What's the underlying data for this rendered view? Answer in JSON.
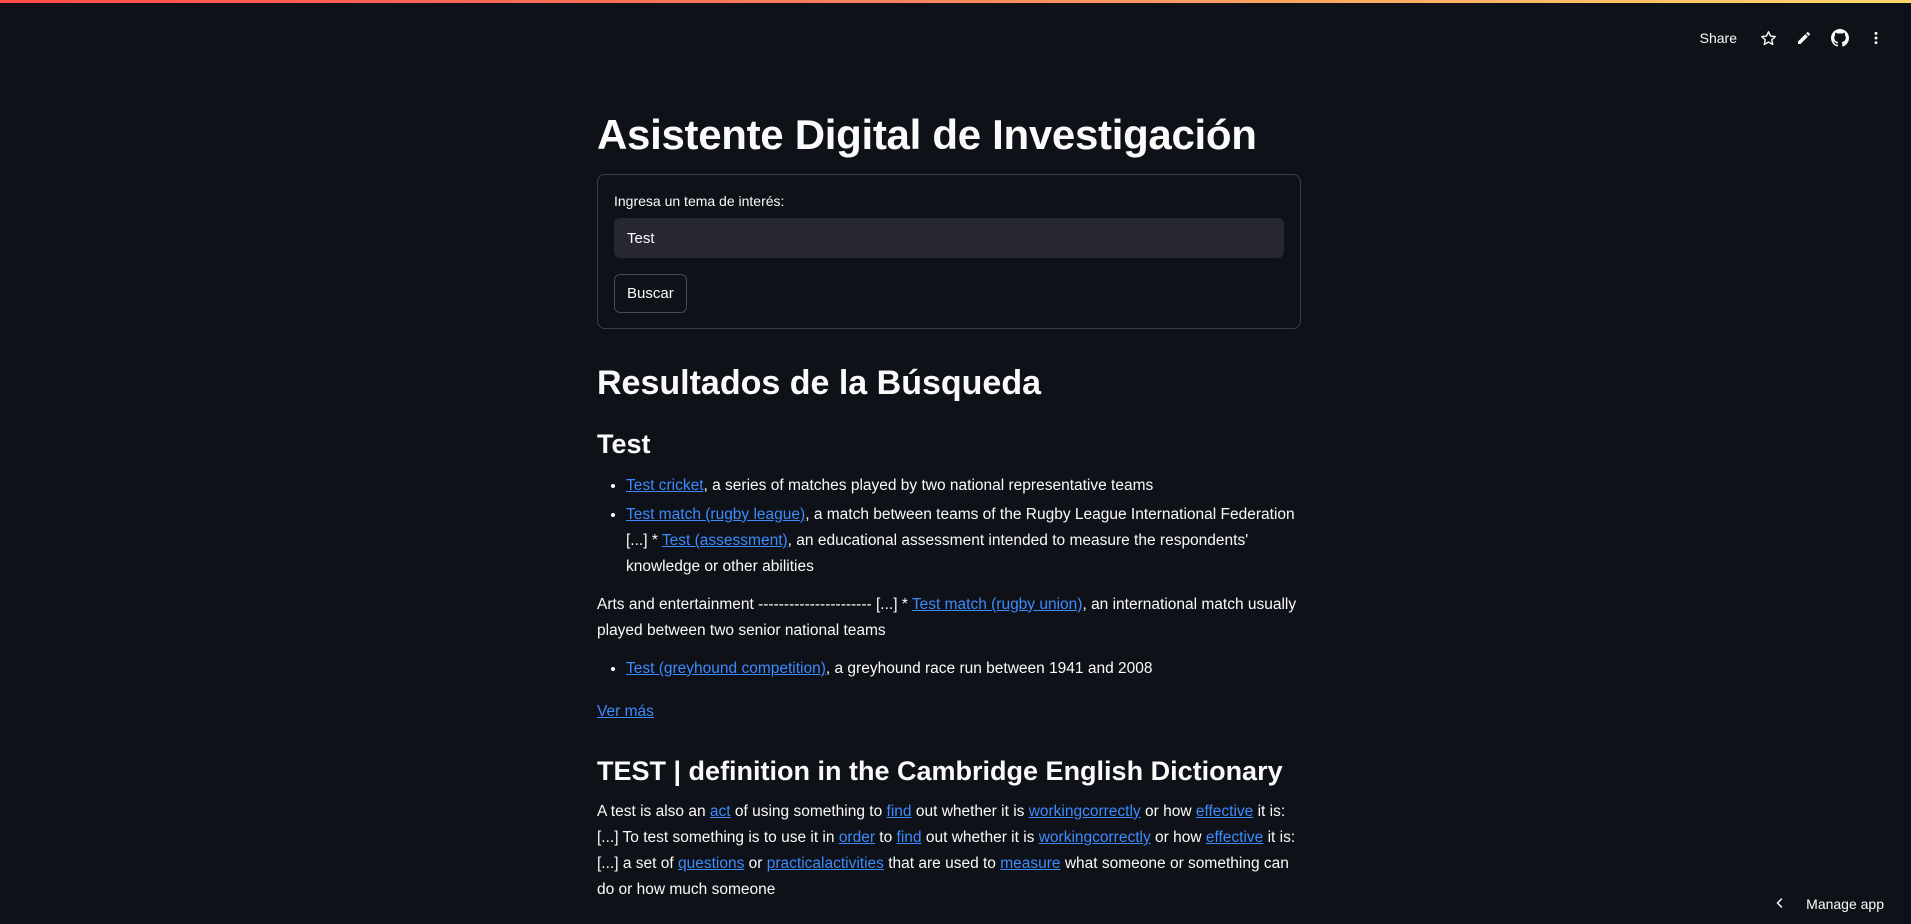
{
  "toolbar": {
    "share_label": "Share",
    "icons": [
      "star-icon",
      "pencil-icon",
      "github-icon",
      "more-vertical-icon"
    ]
  },
  "page": {
    "title": "Asistente Digital de Investigación"
  },
  "form": {
    "label": "Ingresa un tema de interés:",
    "input_value": "Test",
    "button_label": "Buscar"
  },
  "results": {
    "heading": "Resultados de la Búsqueda",
    "section1": {
      "title": "Test",
      "item1": {
        "link": "Test cricket",
        "text": ", a series of matches played by two national representative teams"
      },
      "item2": {
        "link1": "Test match (rugby league)",
        "text1": ", a match between teams of the Rugby League International Federation [...] * ",
        "link2": "Test (assessment)",
        "text2": ", an educational assessment intended to measure the respondents' knowledge or other abilities"
      },
      "para": {
        "text1": "Arts and entertainment ---------------------- [...] * ",
        "link": "Test match (rugby union)",
        "text2": ", an international match usually played between two senior national teams"
      },
      "item3": {
        "link": "Test (greyhound competition)",
        "text": ", a greyhound race run between 1941 and 2008"
      },
      "more_link": "Ver más"
    },
    "section2": {
      "title": "TEST | definition in the Cambridge English Dictionary",
      "t1": "A test is also an ",
      "l1": "act",
      "t2": " of using something to ",
      "l2": "find",
      "t3": " out whether it is ",
      "l3": "workingcorrectly",
      "t4": " or how ",
      "l4": "effective",
      "t5": " it is: [...] To test something is to use it in ",
      "l5": "order",
      "t6": " to ",
      "l6": "find",
      "t7": " out whether it is ",
      "l7": "workingcorrectly",
      "t8": " or how ",
      "l8": "effective",
      "t9": " it is: [...] a set of ",
      "l9": "questions",
      "t10": " or ",
      "l10": "practicalactivities",
      "t11": " that are used to ",
      "l11": "measure",
      "t12": " what someone or something can do or how much someone"
    }
  },
  "footer": {
    "manage_label": "Manage app"
  },
  "colors": {
    "background": "#0e1117",
    "link": "#3d8bfd",
    "input_bg": "#262730"
  }
}
